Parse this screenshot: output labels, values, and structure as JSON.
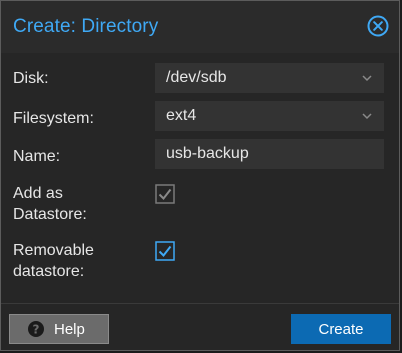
{
  "dialog": {
    "title": "Create: Directory",
    "close_icon": "close-circle-icon"
  },
  "form": {
    "disk": {
      "label": "Disk:",
      "value": "/dev/sdb"
    },
    "filesystem": {
      "label": "Filesystem:",
      "value": "ext4"
    },
    "name": {
      "label": "Name:",
      "value": "usb-backup"
    },
    "add_datastore": {
      "label_line1": "Add as",
      "label_line2": "Datastore:",
      "checked": true,
      "disabled": true
    },
    "removable": {
      "label_line1": "Removable",
      "label_line2": "datastore:",
      "checked": true,
      "disabled": false
    }
  },
  "footer": {
    "help_label": "Help",
    "create_label": "Create"
  },
  "colors": {
    "accent": "#3fa9f5",
    "primary_button": "#0c6ab3",
    "background": "#262626"
  }
}
